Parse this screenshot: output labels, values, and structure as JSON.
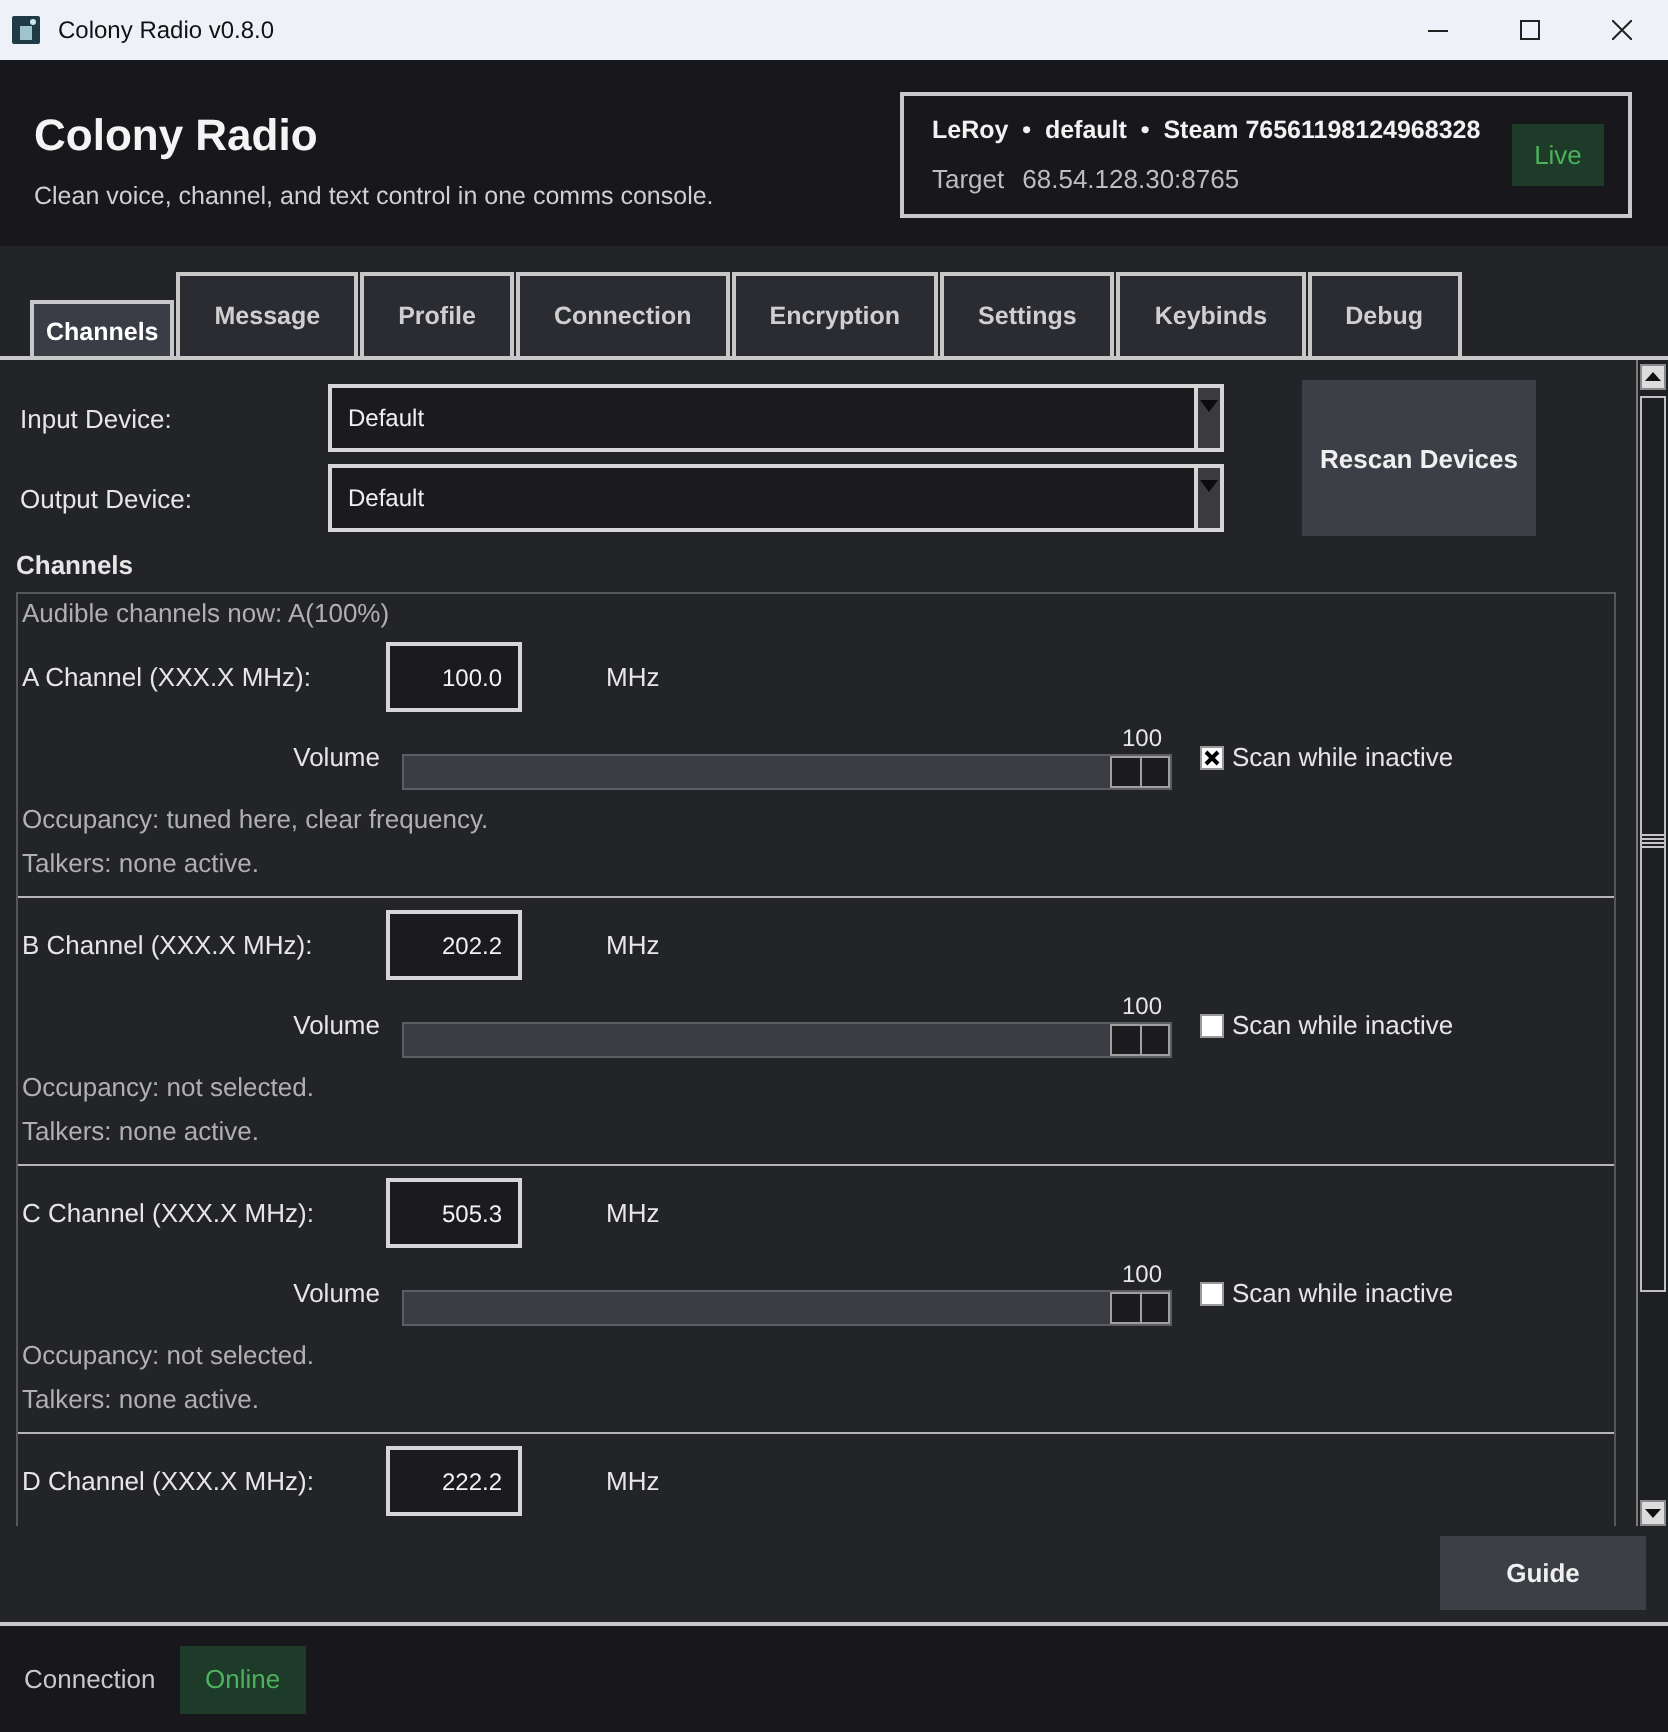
{
  "window": {
    "title": "Colony Radio v0.8.0"
  },
  "header": {
    "title": "Colony Radio",
    "subtitle": "Clean voice, channel, and text control in one comms console.",
    "session": {
      "identity": "LeRoy  •  default  •  Steam 76561198124968328",
      "target_label": "Target",
      "target": "68.54.128.30:8765",
      "badge": "Live"
    }
  },
  "tabs": [
    {
      "label": "Channels",
      "selected": true
    },
    {
      "label": "Message",
      "selected": false
    },
    {
      "label": "Profile",
      "selected": false
    },
    {
      "label": "Connection",
      "selected": false
    },
    {
      "label": "Encryption",
      "selected": false
    },
    {
      "label": "Settings",
      "selected": false
    },
    {
      "label": "Keybinds",
      "selected": false
    },
    {
      "label": "Debug",
      "selected": false
    }
  ],
  "devices": {
    "rows": [
      {
        "label": "Input Device:",
        "value": "Default"
      },
      {
        "label": "Output Device:",
        "value": "Default"
      }
    ],
    "rescan_button": "Rescan Devices"
  },
  "channels": {
    "title": "Channels",
    "audible": "Audible channels now: A(100%)",
    "items": [
      {
        "label": "A Channel (XXX.X MHz):",
        "frequency": "100.0",
        "unit": "MHz",
        "volume": {
          "label": "Volume",
          "reading": "100",
          "level": 1
        },
        "scan": {
          "label": "Scan while inactive",
          "checked": true
        },
        "occupancy": "Occupancy: tuned here, clear frequency.",
        "talkers": "Talkers: none active."
      },
      {
        "label": "B Channel (XXX.X MHz):",
        "frequency": "202.2",
        "unit": "MHz",
        "volume": {
          "label": "Volume",
          "reading": "100",
          "level": 1
        },
        "scan": {
          "label": "Scan while inactive",
          "checked": false
        },
        "occupancy": "Occupancy: not selected.",
        "talkers": "Talkers: none active."
      },
      {
        "label": "C Channel (XXX.X MHz):",
        "frequency": "505.3",
        "unit": "MHz",
        "volume": {
          "label": "Volume",
          "reading": "100",
          "level": 1
        },
        "scan": {
          "label": "Scan while inactive",
          "checked": false
        },
        "occupancy": "Occupancy: not selected.",
        "talkers": "Talkers: none active."
      },
      {
        "label": "D Channel (XXX.X MHz):",
        "frequency": "222.2",
        "unit": "MHz"
      }
    ]
  },
  "guide_button": "Guide",
  "status_bar": {
    "label": "Connection",
    "badge": "Online"
  }
}
